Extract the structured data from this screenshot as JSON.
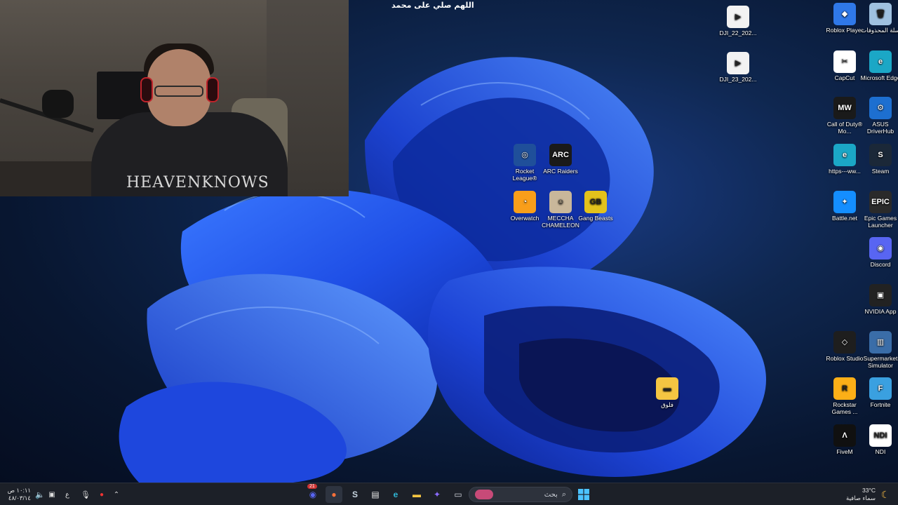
{
  "overlay_caption": "اللهم صلي على محمد",
  "webcam": {
    "shirt_text": "HEAVENKNOWS"
  },
  "desktop_icons": [
    {
      "id": "dji22",
      "label": "DJI_22_202...",
      "color": "#f2f2f2",
      "glyph": "▶"
    },
    {
      "id": "dji23",
      "label": "DJI_23_202...",
      "color": "#f2f2f2",
      "glyph": "▶"
    },
    {
      "id": "roblox-player",
      "label": "Roblox Player",
      "color": "#2f78e8",
      "glyph": "◆"
    },
    {
      "id": "recycle-bin",
      "label": "سلة المحذوفات",
      "color": "#9fc1e0",
      "glyph": "🗑"
    },
    {
      "id": "capcut",
      "label": "CapCut",
      "color": "#ffffff",
      "glyph": "✂"
    },
    {
      "id": "edge",
      "label": "Microsoft Edge",
      "color": "#1ba7c6",
      "glyph": "e"
    },
    {
      "id": "cod",
      "label": "Call of Duty® Mo...",
      "color": "#1a1a1a",
      "glyph": "MW"
    },
    {
      "id": "asus",
      "label": "ASUS DriverHub",
      "color": "#1d6fd0",
      "glyph": "⚙"
    },
    {
      "id": "edge-link",
      "label": "https---ww...",
      "color": "#1ba7c6",
      "glyph": "e"
    },
    {
      "id": "steam",
      "label": "Steam",
      "color": "#1b2838",
      "glyph": "S"
    },
    {
      "id": "battlenet",
      "label": "Battle.net",
      "color": "#148eff",
      "glyph": "✦"
    },
    {
      "id": "epic",
      "label": "Epic Games Launcher",
      "color": "#2a2a2a",
      "glyph": "EPIC"
    },
    {
      "id": "discord",
      "label": "Discord",
      "color": "#5865f2",
      "glyph": "◉"
    },
    {
      "id": "nvidia",
      "label": "NVIDIA App",
      "color": "#222",
      "glyph": "▣"
    },
    {
      "id": "roblox-studio",
      "label": "Roblox Studio",
      "color": "#1e1e1e",
      "glyph": "◇"
    },
    {
      "id": "supermarket",
      "label": "Supermarket Simulator",
      "color": "#3a6da8",
      "glyph": "▥"
    },
    {
      "id": "rockstar",
      "label": "Rockstar Games ...",
      "color": "#fcaf17",
      "glyph": "R"
    },
    {
      "id": "fortnite",
      "label": "Fortnite",
      "color": "#3aa0e0",
      "glyph": "F"
    },
    {
      "id": "fivem",
      "label": "FiveM",
      "color": "#101010",
      "glyph": "Λ"
    },
    {
      "id": "ndi",
      "label": "NDI",
      "color": "#ffffff",
      "glyph": "NDI"
    },
    {
      "id": "rocket-league",
      "label": "Rocket League®",
      "color": "#1f4f9a",
      "glyph": "◎"
    },
    {
      "id": "arc-raiders",
      "label": "ARC Raiders",
      "color": "#1a1a1a",
      "glyph": "ARC"
    },
    {
      "id": "overwatch",
      "label": "Overwatch",
      "color": "#f99e1a",
      "glyph": "◔"
    },
    {
      "id": "meccha",
      "label": "MECCHA CHAMELEON",
      "color": "#c9b79a",
      "glyph": "☺"
    },
    {
      "id": "gang-beasts",
      "label": "Gang Beasts",
      "color": "#e3c21c",
      "glyph": "GB"
    },
    {
      "id": "folder",
      "label": "فلوق",
      "color": "#f5c542",
      "glyph": "▬"
    }
  ],
  "taskbar": {
    "search_placeholder": "بحث",
    "start_icon": "windows-start-icon",
    "pinned": [
      {
        "id": "discord",
        "glyph": "◉",
        "color": "#5865f2"
      },
      {
        "id": "firefox",
        "glyph": "●",
        "color": "#ff7139"
      },
      {
        "id": "steam",
        "glyph": "S",
        "color": "#c7d5e0"
      },
      {
        "id": "store",
        "glyph": "▤",
        "color": "#e8e8e8"
      },
      {
        "id": "edge",
        "glyph": "e",
        "color": "#2fb7d6"
      },
      {
        "id": "explorer",
        "glyph": "▬",
        "color": "#f5c542"
      },
      {
        "id": "copilot",
        "glyph": "✦",
        "color": "#8b6cff"
      },
      {
        "id": "window",
        "glyph": "▭",
        "color": "#cfd3da"
      }
    ],
    "discord_badge": "21",
    "weather_temp": "33°C",
    "weather_desc": "سماء صافية",
    "time": "١٠:١١ ص",
    "date": "٤٨/٠٣/١٤",
    "lang": "ع"
  }
}
